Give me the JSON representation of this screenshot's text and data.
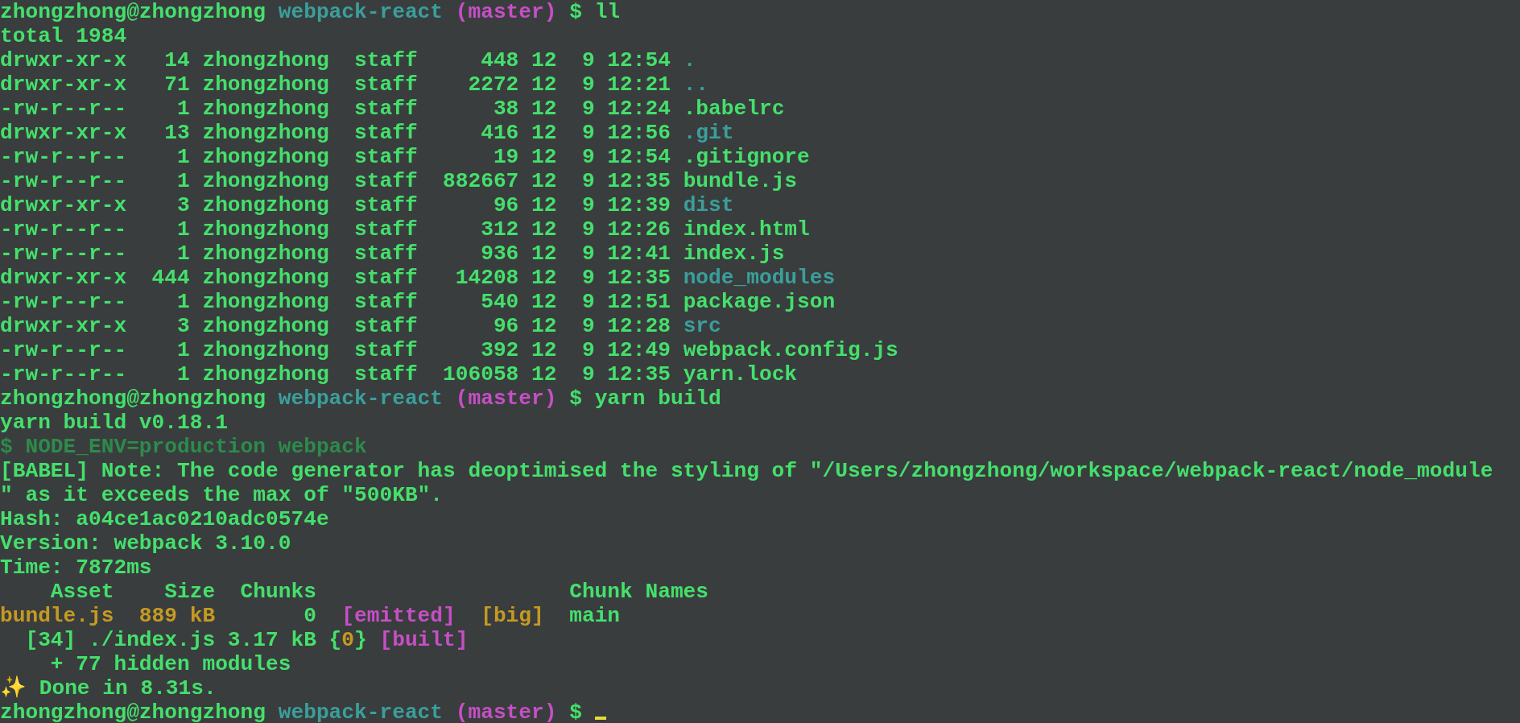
{
  "terminal": {
    "lines": [
      {
        "segments": [
          {
            "kind": "user",
            "text": "zhongzhong@zhongzhong "
          },
          {
            "kind": "path",
            "text": "webpack-react "
          },
          {
            "kind": "branch",
            "text": "(master)"
          },
          {
            "kind": "out",
            "text": " $ ll"
          }
        ]
      },
      {
        "segments": [
          {
            "kind": "out",
            "text": "total 1984"
          }
        ]
      },
      {
        "segments": [
          {
            "kind": "out",
            "text": "drwxr-xr-x   14 zhongzhong  staff     448 12  9 12:54 "
          },
          {
            "kind": "dir",
            "text": "."
          }
        ]
      },
      {
        "segments": [
          {
            "kind": "out",
            "text": "drwxr-xr-x   71 zhongzhong  staff    2272 12  9 12:21 "
          },
          {
            "kind": "dir",
            "text": ".."
          }
        ]
      },
      {
        "segments": [
          {
            "kind": "out",
            "text": "-rw-r--r--    1 zhongzhong  staff      38 12  9 12:24 "
          },
          {
            "kind": "out",
            "text": ".babelrc"
          }
        ]
      },
      {
        "segments": [
          {
            "kind": "out",
            "text": "drwxr-xr-x   13 zhongzhong  staff     416 12  9 12:56 "
          },
          {
            "kind": "dir",
            "text": ".git"
          }
        ]
      },
      {
        "segments": [
          {
            "kind": "out",
            "text": "-rw-r--r--    1 zhongzhong  staff      19 12  9 12:54 "
          },
          {
            "kind": "out",
            "text": ".gitignore"
          }
        ]
      },
      {
        "segments": [
          {
            "kind": "out",
            "text": "-rw-r--r--    1 zhongzhong  staff  882667 12  9 12:35 "
          },
          {
            "kind": "out",
            "text": "bundle.js"
          }
        ]
      },
      {
        "segments": [
          {
            "kind": "out",
            "text": "drwxr-xr-x    3 zhongzhong  staff      96 12  9 12:39 "
          },
          {
            "kind": "dir",
            "text": "dist"
          }
        ]
      },
      {
        "segments": [
          {
            "kind": "out",
            "text": "-rw-r--r--    1 zhongzhong  staff     312 12  9 12:26 "
          },
          {
            "kind": "out",
            "text": "index.html"
          }
        ]
      },
      {
        "segments": [
          {
            "kind": "out",
            "text": "-rw-r--r--    1 zhongzhong  staff     936 12  9 12:41 "
          },
          {
            "kind": "out",
            "text": "index.js"
          }
        ]
      },
      {
        "segments": [
          {
            "kind": "out",
            "text": "drwxr-xr-x  444 zhongzhong  staff   14208 12  9 12:35 "
          },
          {
            "kind": "dir",
            "text": "node_modules"
          }
        ]
      },
      {
        "segments": [
          {
            "kind": "out",
            "text": "-rw-r--r--    1 zhongzhong  staff     540 12  9 12:51 "
          },
          {
            "kind": "out",
            "text": "package.json"
          }
        ]
      },
      {
        "segments": [
          {
            "kind": "out",
            "text": "drwxr-xr-x    3 zhongzhong  staff      96 12  9 12:28 "
          },
          {
            "kind": "dir",
            "text": "src"
          }
        ]
      },
      {
        "segments": [
          {
            "kind": "out",
            "text": "-rw-r--r--    1 zhongzhong  staff     392 12  9 12:49 "
          },
          {
            "kind": "out",
            "text": "webpack.config.js"
          }
        ]
      },
      {
        "segments": [
          {
            "kind": "out",
            "text": "-rw-r--r--    1 zhongzhong  staff  106058 12  9 12:35 "
          },
          {
            "kind": "out",
            "text": "yarn.lock"
          }
        ]
      },
      {
        "segments": [
          {
            "kind": "user",
            "text": "zhongzhong@zhongzhong "
          },
          {
            "kind": "path",
            "text": "webpack-react "
          },
          {
            "kind": "branch",
            "text": "(master)"
          },
          {
            "kind": "out",
            "text": " $ yarn build"
          }
        ]
      },
      {
        "segments": [
          {
            "kind": "out",
            "text": "yarn build v0.18.1"
          }
        ]
      },
      {
        "segments": [
          {
            "kind": "dim",
            "text": "$ NODE_ENV=production webpack"
          }
        ]
      },
      {
        "segments": [
          {
            "kind": "out",
            "text": "[BABEL] Note: The code generator has deoptimised the styling of \"/Users/zhongzhong/workspace/webpack-react/node_module"
          }
        ]
      },
      {
        "segments": [
          {
            "kind": "out",
            "text": "\" as it exceeds the max of \"500KB\"."
          }
        ]
      },
      {
        "segments": [
          {
            "kind": "out",
            "text": "Hash: a04ce1ac0210adc0574e"
          }
        ]
      },
      {
        "segments": [
          {
            "kind": "out",
            "text": "Version: webpack 3.10.0"
          }
        ]
      },
      {
        "segments": [
          {
            "kind": "out",
            "text": "Time: 7872ms"
          }
        ]
      },
      {
        "segments": [
          {
            "kind": "out",
            "text": "    Asset    Size  Chunks                    Chunk Names"
          }
        ]
      },
      {
        "segments": [
          {
            "kind": "warn",
            "text": "bundle.js  889 kB"
          },
          {
            "kind": "out",
            "text": "       0  "
          },
          {
            "kind": "branch",
            "text": "[emitted]  "
          },
          {
            "kind": "warn",
            "text": "[big]"
          },
          {
            "kind": "out",
            "text": "  main"
          }
        ]
      },
      {
        "segments": [
          {
            "kind": "out",
            "text": "  [34] ./index.js 3.17 kB {"
          },
          {
            "kind": "warn",
            "text": "0"
          },
          {
            "kind": "out",
            "text": "} "
          },
          {
            "kind": "branch",
            "text": "[built]"
          }
        ]
      },
      {
        "segments": [
          {
            "kind": "out",
            "text": "    + 77 hidden modules"
          }
        ]
      },
      {
        "segments": [
          {
            "kind": "sparkle",
            "text": "✨"
          },
          {
            "kind": "out",
            "text": " Done in 8.31s."
          }
        ]
      },
      {
        "segments": [
          {
            "kind": "user",
            "text": "zhongzhong@zhongzhong "
          },
          {
            "kind": "path",
            "text": "webpack-react "
          },
          {
            "kind": "branch",
            "text": "(master)"
          },
          {
            "kind": "out",
            "text": " $ "
          }
        ],
        "cursor": true
      }
    ]
  }
}
